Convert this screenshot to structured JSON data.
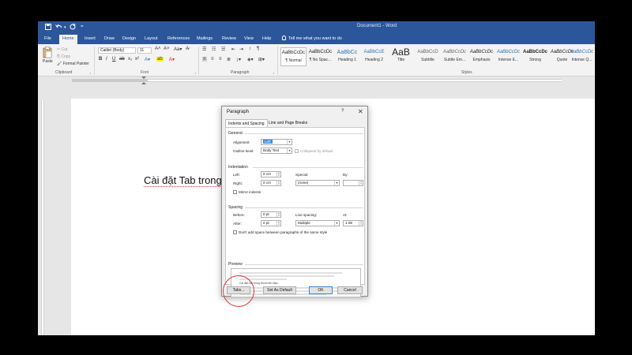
{
  "titlebar": {
    "save_icon": "save-icon",
    "undo_icon": "undo-icon",
    "redo_icon": "redo-icon",
    "document_title": "Document1 - Word"
  },
  "tabs": [
    "File",
    "Home",
    "Insert",
    "Draw",
    "Design",
    "Layout",
    "References",
    "Mailings",
    "Review",
    "View",
    "Help"
  ],
  "active_tab": "Home",
  "tell_me": "Tell me what you want to do",
  "ribbon": {
    "clipboard": {
      "paste": "Paste",
      "cut": "Cut",
      "copy": "Copy",
      "format_painter": "Format Painter",
      "label": "Clipboard"
    },
    "font": {
      "family": "Calibri (Body)",
      "size": "11",
      "label": "Font"
    },
    "paragraph": {
      "label": "Paragraph"
    },
    "styles": {
      "label": "Styles",
      "items": [
        {
          "sample": "AaBbCcDc",
          "name": "¶ Normal"
        },
        {
          "sample": "AaBbCcDc",
          "name": "¶ No Spac..."
        },
        {
          "sample": "AaBbCc",
          "name": "Heading 1"
        },
        {
          "sample": "AaBbCcE",
          "name": "Heading 2"
        },
        {
          "sample": "AaB",
          "name": "Title"
        },
        {
          "sample": "AaBbCcD",
          "name": "Subtitle"
        },
        {
          "sample": "AaBbCcDc",
          "name": "Subtle Em..."
        },
        {
          "sample": "AaBbCcDc",
          "name": "Emphasis"
        },
        {
          "sample": "AaBbCcDc",
          "name": "Intense E..."
        },
        {
          "sample": "AaBbCcDc",
          "name": "Strong"
        },
        {
          "sample": "AaBbCcDc",
          "name": "Quote"
        },
        {
          "sample": "AaBbCcDc",
          "name": "Intense Q..."
        }
      ]
    }
  },
  "document": {
    "text": "Cài đặt Tab trong"
  },
  "dialog": {
    "title": "Paragraph",
    "help": "?",
    "close": "✕",
    "tabs": [
      "Indents and Spacing",
      "Line and Page Breaks"
    ],
    "general": {
      "heading": "General",
      "alignment_label": "Alignment:",
      "alignment_value": "Left",
      "outline_label": "Outline level:",
      "outline_value": "Body Text",
      "collapsed_label": "Collapsed by default"
    },
    "indentation": {
      "heading": "Indentation",
      "left_label": "Left:",
      "left_value": "0 cm",
      "right_label": "Right:",
      "right_value": "0 cm",
      "special_label": "Special:",
      "special_value": "(none)",
      "by_label": "By:",
      "mirror_label": "Mirror indents"
    },
    "spacing": {
      "heading": "Spacing",
      "before_label": "Before:",
      "before_value": "0 pt",
      "after_label": "After:",
      "after_value": "0 pt",
      "line_label": "Line spacing:",
      "line_value": "Multiple",
      "at_label": "At:",
      "at_value": "1.08",
      "dont_add_label": "Don't add space between paragraphs of the same style"
    },
    "preview": {
      "heading": "Preview",
      "sample": "Cài đặt Tab trong Word trên Mac"
    },
    "buttons": {
      "tabs": "Tabs...",
      "set_default": "Set As Default",
      "ok": "OK",
      "cancel": "Cancel"
    }
  },
  "colors": {
    "word_blue": "#2b579a",
    "highlight": "#e23a3a"
  }
}
